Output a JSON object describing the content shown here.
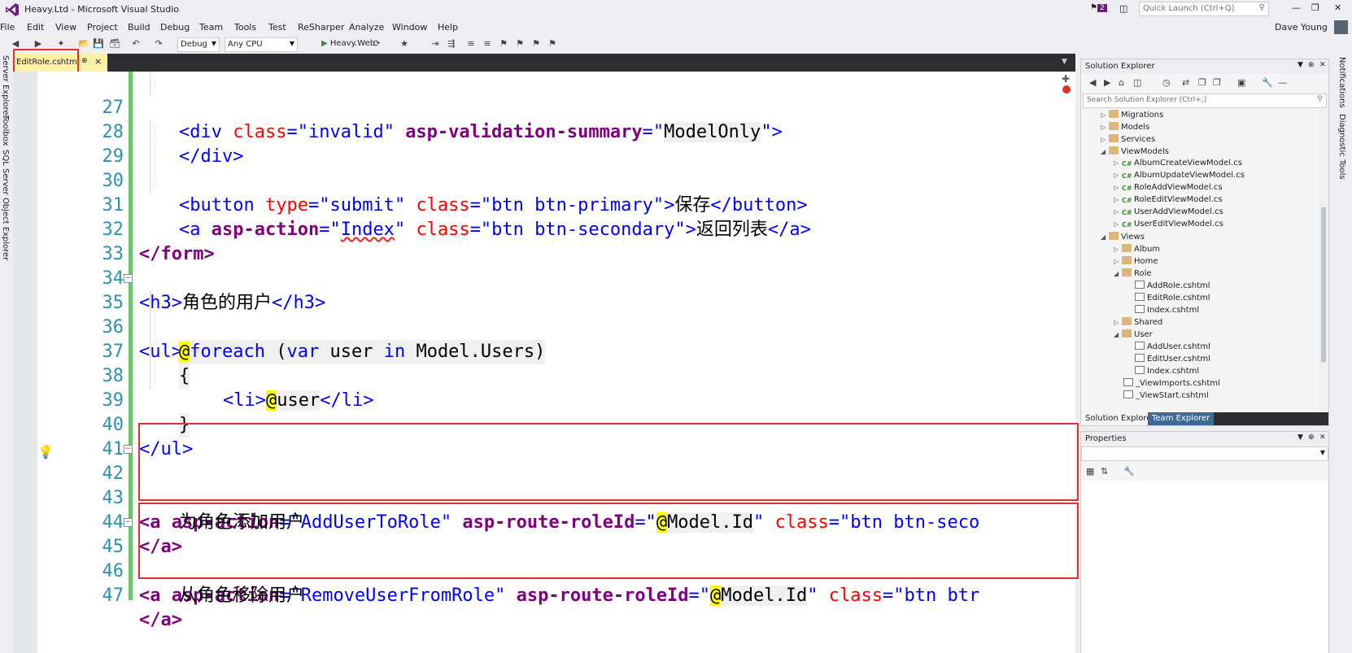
{
  "window": {
    "title": "Heavy.Ltd - Microsoft Visual Studio",
    "notifications_count": "2",
    "quick_launch_placeholder": "Quick Launch (Ctrl+Q)",
    "user_name": "Dave Young"
  },
  "menu": [
    "File",
    "Edit",
    "View",
    "Project",
    "Build",
    "Debug",
    "Team",
    "Tools",
    "Test",
    "ReSharper",
    "Analyze",
    "Window",
    "Help"
  ],
  "toolbar": {
    "configuration": "Debug",
    "platform": "Any CPU",
    "run_target": "Heavy.Web"
  },
  "left_tabs": [
    "Server Explorer",
    "Toolbox",
    "SQL Server Object Explorer"
  ],
  "right_tabs": [
    "Notifications",
    "Diagnostic Tools"
  ],
  "editor": {
    "active_tab": "EditRole.cshtml",
    "line_numbers": [
      "27",
      "28",
      "29",
      "30",
      "31",
      "32",
      "33",
      "34",
      "35",
      "36",
      "37",
      "38",
      "39",
      "40",
      "41",
      "42",
      "43",
      "44",
      "45",
      "46",
      "47"
    ],
    "lines": {
      "l27": {
        "t1": "<div ",
        "a1": "class",
        "e1": "=\"",
        "v1": "invalid",
        "e2": "\" ",
        "a2": "asp-validation-summary",
        "e3": "=\"",
        "v2": "ModelOnly",
        "e4": "\">"
      },
      "l28": {
        "t1": "</div>"
      },
      "l30": {
        "t1": "<button ",
        "a1": "type",
        "e1": "=\"",
        "v1": "submit",
        "e2": "\" ",
        "a2": "class",
        "e3": "=\"",
        "v2": "btn btn-primary",
        "e4": "\">",
        "text": "保存",
        "t2": "</button>"
      },
      "l31": {
        "t1": "<a ",
        "a1": "asp-action",
        "e1": "=\"",
        "v1": "Index",
        "e2": "\" ",
        "a2": "class",
        "e3": "=\"",
        "v2": "btn btn-secondary",
        "e4": "\">",
        "text": "返回列表",
        "t2": "</a>"
      },
      "l32": {
        "t1": "</form>"
      },
      "l34": {
        "t1": "<h3>",
        "text": "角色的用户",
        "t2": "</h3>"
      },
      "l35": {
        "t1": "<ul>"
      },
      "l36": {
        "at": "@",
        "kw1": "foreach",
        "p1": " (",
        "kw2": "var",
        "p2": " user ",
        "kw3": "in",
        "p3": " Model.Users)"
      },
      "l37": {
        "t1": "{"
      },
      "l38": {
        "t1": "<li>",
        "at": "@",
        "var": "user",
        "t2": "</li>"
      },
      "l39": {
        "t1": "}"
      },
      "l40": {
        "t1": "</ul>"
      },
      "l42": {
        "t1": "<a ",
        "a1": "asp-action",
        "e1": "=\"",
        "v1": "AddUserToRole",
        "e2": "\" ",
        "a2": "asp-route-roleId",
        "e3": "=\"",
        "at": "@",
        "m": "Model.Id",
        "e4": "\" ",
        "a3": "class",
        "e5": "=\"",
        "v3": "btn btn-seco"
      },
      "l43": {
        "text": "为角色添加用户"
      },
      "l44": {
        "t1": "</a>"
      },
      "l45": {
        "t1": "<a ",
        "a1": "asp-action",
        "e1": "=\"",
        "v1": "RemoveUserFromRole",
        "e2": "\" ",
        "a2": "asp-route-roleId",
        "e3": "=\"",
        "at": "@",
        "m": "Model.Id",
        "e4": "\" ",
        "a3": "class",
        "e5": "=\"",
        "v3": "btn btr"
      },
      "l46": {
        "text": "从角色移除用户"
      },
      "l47": {
        "t1": "</a>"
      }
    }
  },
  "solution_explorer": {
    "title": "Solution Explorer",
    "search_placeholder": "Search Solution Explorer (Ctrl+;)",
    "items": [
      "Migrations",
      "Models",
      "Services",
      "ViewModels",
      "AlbumCreateViewModel.cs",
      "AlbumUpdateViewModel.cs",
      "RoleAddViewModel.cs",
      "RoleEditViewModel.cs",
      "UserAddViewModel.cs",
      "UserEditViewModel.cs",
      "Views",
      "Album",
      "Home",
      "Role",
      "AddRole.cshtml",
      "EditRole.cshtml",
      "Index.cshtml",
      "Shared",
      "User",
      "AddUser.cshtml",
      "EditUser.cshtml",
      "Index.cshtml",
      "_ViewImports.cshtml",
      "_ViewStart.cshtml"
    ],
    "tabs": [
      "Solution Explorer",
      "Team Explorer"
    ]
  },
  "properties": {
    "title": "Properties"
  },
  "colors": {
    "highlight_box": "#e03030",
    "line_number": "#2b91af",
    "tag": "#800000",
    "attribute": "#ff0000",
    "string": "#0000ff",
    "tag_helper": "#800080",
    "razor_highlight": "#ffff00",
    "change_bar": "#6bc46b"
  }
}
